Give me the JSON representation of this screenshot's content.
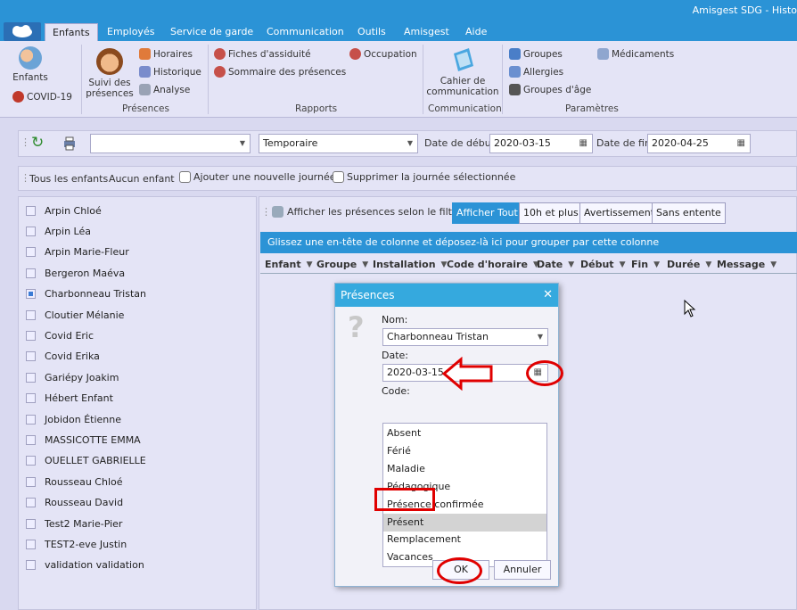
{
  "window": {
    "title": "Amisgest SDG - Histo"
  },
  "tabs": [
    {
      "label": "Enfants",
      "active": true
    },
    {
      "label": "Employés"
    },
    {
      "label": "Service de garde"
    },
    {
      "label": "Communication"
    },
    {
      "label": "Outils"
    },
    {
      "label": "Amisgest"
    },
    {
      "label": "Aide"
    }
  ],
  "ribbon": {
    "enfants": "Enfants",
    "covid": "COVID-19",
    "suivi": "Suivi des présences",
    "horaires": "Horaires",
    "historique": "Historique",
    "analyse": "Analyse",
    "presences_group": "Présences",
    "fiches": "Fiches d'assiduité",
    "sommaire": "Sommaire des présences",
    "occupation": "Occupation",
    "rapports_group": "Rapports",
    "cahier": "Cahier de communication",
    "communication_group": "Communication",
    "groupes": "Groupes",
    "allergies": "Allergies",
    "groupes_age": "Groupes d'âge",
    "medicaments": "Médicaments",
    "parametres_group": "Paramètres"
  },
  "toolbar1": {
    "type_select": "Temporaire",
    "date_debut_label": "Date de début",
    "date_debut": "2020-03-15",
    "date_fin_label": "Date de fin",
    "date_fin": "2020-04-25"
  },
  "toolbar2": {
    "tous": "Tous les enfants",
    "aucun": "Aucun enfant",
    "ajouter": "Ajouter une nouvelle journée",
    "supprimer": "Supprimer la journée sélectionnée"
  },
  "children": [
    {
      "name": "Arpin Chloé",
      "checked": false
    },
    {
      "name": "Arpin Léa",
      "checked": false
    },
    {
      "name": "Arpin Marie-Fleur",
      "checked": false
    },
    {
      "name": "Bergeron Maéva",
      "checked": false
    },
    {
      "name": "Charbonneau Tristan",
      "checked": true
    },
    {
      "name": "Cloutier Mélanie",
      "checked": false
    },
    {
      "name": "Covid Eric",
      "checked": false
    },
    {
      "name": "Covid Erika",
      "checked": false
    },
    {
      "name": "Gariépy Joakim",
      "checked": false
    },
    {
      "name": "Hébert Enfant",
      "checked": false
    },
    {
      "name": "Jobidon  Étienne",
      "checked": false
    },
    {
      "name": "MASSICOTTE EMMA",
      "checked": false
    },
    {
      "name": "OUELLET GABRIELLE",
      "checked": false
    },
    {
      "name": "Rousseau Chloé",
      "checked": false
    },
    {
      "name": "Rousseau David",
      "checked": false
    },
    {
      "name": "Test2 Marie-Pier",
      "checked": false
    },
    {
      "name": "TEST2-eve Justin",
      "checked": false
    },
    {
      "name": "validation validation",
      "checked": false
    }
  ],
  "filters": {
    "afficher_filtre": "Afficher les présences selon le filtre",
    "afficher_tout": "Afficher Tout",
    "dix_heures": "10h et plus",
    "avertissement": "Avertissement",
    "sans_entente": "Sans entente"
  },
  "groupbar": "Glissez une en-tête de colonne et déposez-là ici pour grouper par cette colonne",
  "columns": [
    "Enfant",
    "Groupe",
    "Installation",
    "Code d'horaire",
    "Date",
    "Début",
    "Fin",
    "Durée",
    "Message"
  ],
  "dialog": {
    "title": "Présences",
    "nom_label": "Nom:",
    "nom_value": "Charbonneau Tristan",
    "date_label": "Date:",
    "date_value": "2020-03-15",
    "code_label": "Code:",
    "codes": [
      "Absent",
      "Férié",
      "Maladie",
      "Pédagogique",
      "Présence confirmée",
      "Présent",
      "Remplacement",
      "Vacances"
    ],
    "selected_code": "Présent",
    "ok": "OK",
    "annuler": "Annuler"
  },
  "colors": {
    "accent": "#2b93d6",
    "annotation": "#e00000"
  }
}
